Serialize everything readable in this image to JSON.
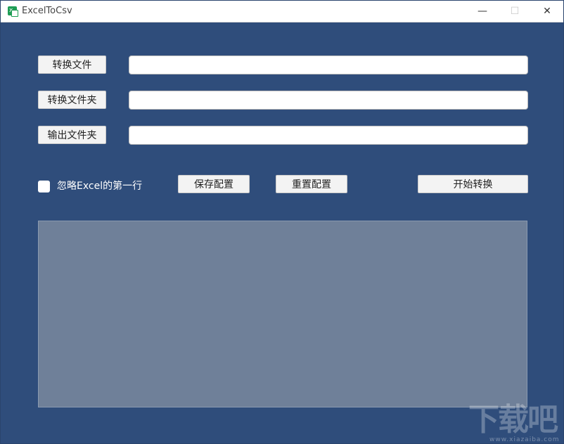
{
  "window": {
    "title": "ExcelToCsv",
    "minimize": "—",
    "maximize": "☐",
    "close": "✕"
  },
  "rows": {
    "convert_file_label": "转换文件",
    "convert_folder_label": "转换文件夹",
    "output_folder_label": "输出文件夹",
    "convert_file_value": "",
    "convert_folder_value": "",
    "output_folder_value": ""
  },
  "options": {
    "skip_first_row_label": "忽略Excel的第一行",
    "skip_first_row_checked": false
  },
  "actions": {
    "save_config": "保存配置",
    "reset_config": "重置配置",
    "start_convert": "开始转换"
  },
  "watermark": {
    "main": "下载吧",
    "sub": "www.xiazaiba.com"
  },
  "colors": {
    "background": "#2f4d7b",
    "log_area": "#6f8099",
    "button": "#f3f3f3"
  }
}
